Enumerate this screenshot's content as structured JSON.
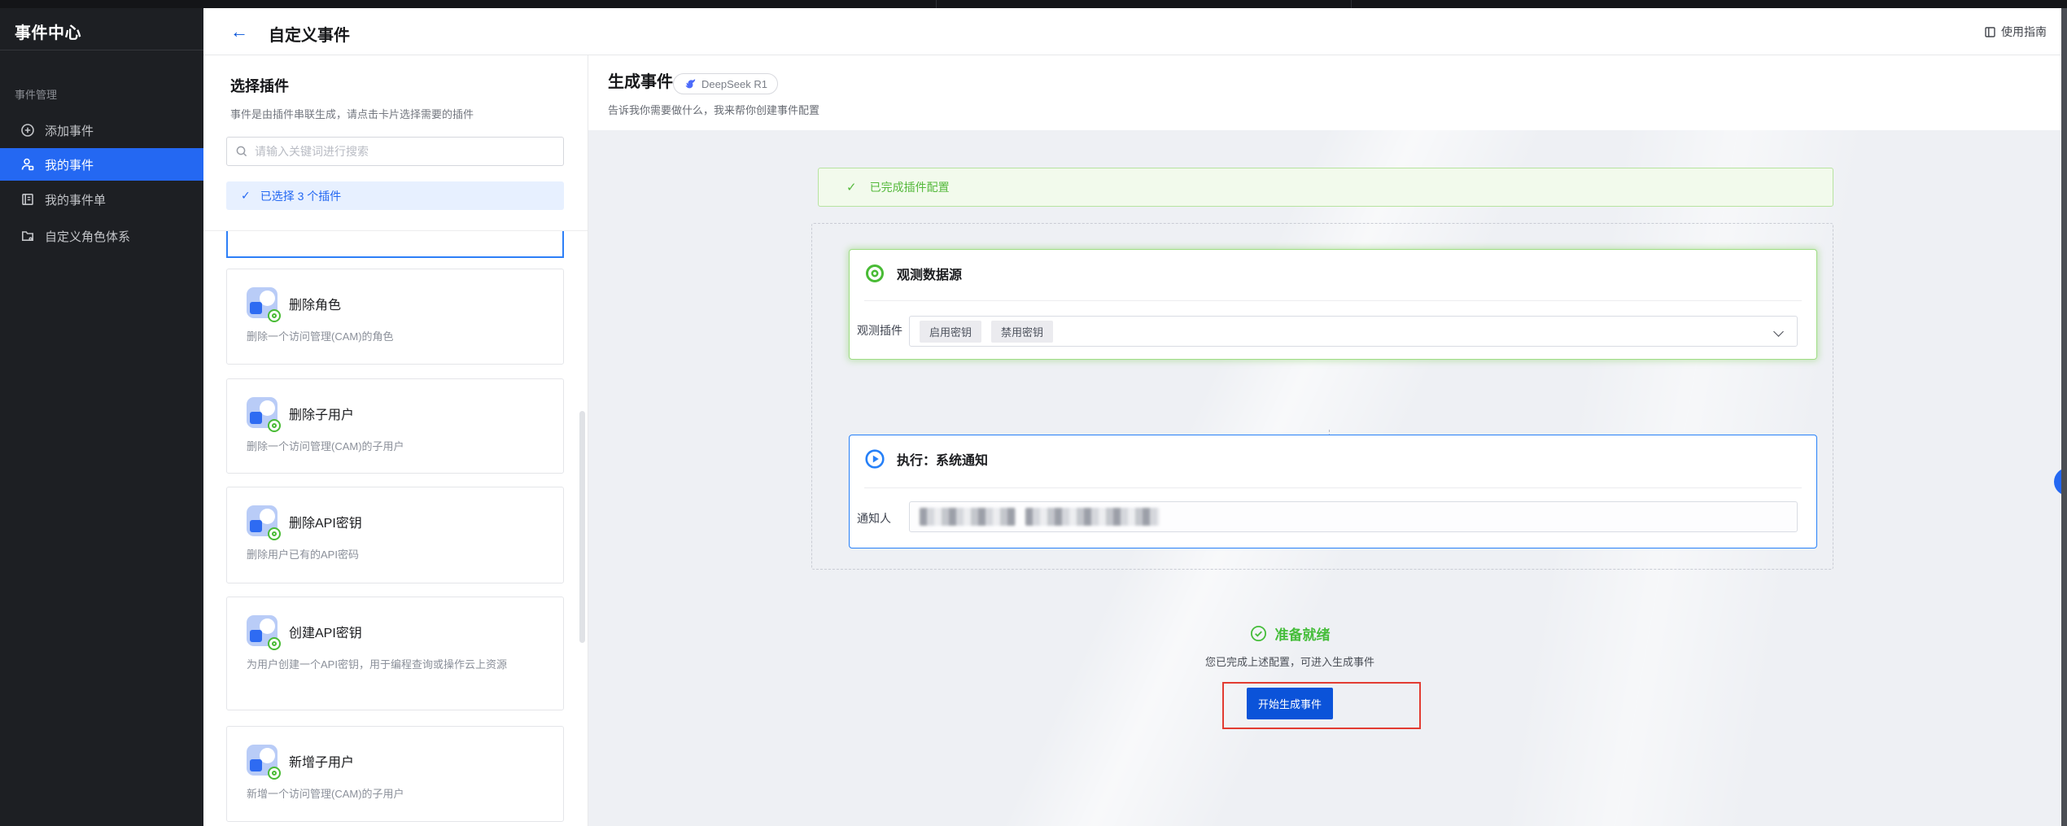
{
  "topbar": {},
  "sidebar": {
    "title": "事件中心",
    "section_label": "事件管理",
    "items": [
      {
        "label": "添加事件",
        "icon": "add-event-icon",
        "active": false
      },
      {
        "label": "我的事件",
        "icon": "my-events-icon",
        "active": true
      },
      {
        "label": "我的事件单",
        "icon": "event-tickets-icon",
        "active": false
      },
      {
        "label": "自定义角色体系",
        "icon": "custom-roles-icon",
        "active": false
      }
    ]
  },
  "header": {
    "title": "自定义事件",
    "guide_label": "使用指南"
  },
  "plugin_panel": {
    "title": "选择插件",
    "description": "事件是由插件串联生成，请点击卡片选择需要的插件",
    "search_placeholder": "请输入关键词进行搜索",
    "selected_banner": "已选择 3 个插件",
    "check_glyph": "✓",
    "cards": [
      {
        "title": "删除角色",
        "description": "删除一个访问管理(CAM)的角色"
      },
      {
        "title": "删除子用户",
        "description": "删除一个访问管理(CAM)的子用户"
      },
      {
        "title": "删除API密钥",
        "description": "删除用户已有的API密码"
      },
      {
        "title": "创建API密钥",
        "description": "为用户创建一个API密钥，用于编程查询或操作云上资源"
      },
      {
        "title": "新增子用户",
        "description": "新增一个访问管理(CAM)的子用户"
      }
    ]
  },
  "generator": {
    "title": "生成事件",
    "model_badge": "DeepSeek R1",
    "subtitle": "告诉我你需要做什么，我来帮你创建事件配置",
    "done_banner": "已完成插件配置",
    "check_glyph": "✓",
    "observe_card": {
      "title": "观测数据源",
      "field_label": "观测插件",
      "tags": [
        "启用密钥",
        "禁用密钥"
      ]
    },
    "execute_card": {
      "title": "执行：系统通知",
      "field_label": "通知人",
      "redacted_tag_count": 2
    },
    "ready": {
      "title": "准备就绪",
      "subtitle": "您已完成上述配置，可进入生成事件",
      "button_label": "开始生成事件"
    }
  },
  "colors": {
    "primary_blue": "#2468f2",
    "button_blue": "#0b53d9",
    "success_green": "#49bb35",
    "annotation_red": "#e23c32",
    "sidebar_bg": "#1d1f23",
    "canvas_bg": "#eef0f4"
  }
}
